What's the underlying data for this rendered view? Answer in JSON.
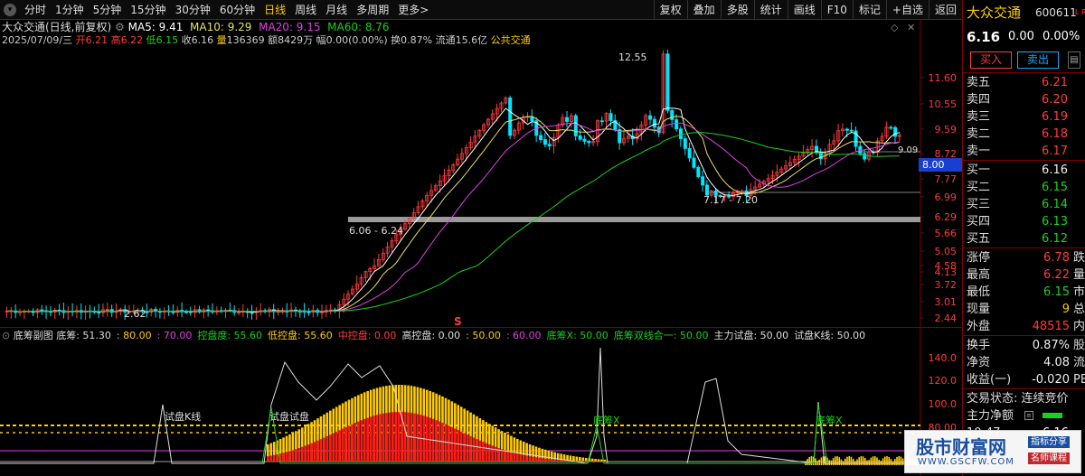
{
  "toolbar": {
    "periods": [
      "分时",
      "1分钟",
      "5分钟",
      "15分钟",
      "30分钟",
      "60分钟",
      "日线",
      "周线",
      "月线",
      "多周期",
      "更多>"
    ],
    "active_period": "日线",
    "buttons": [
      "复权",
      "叠加",
      "多股",
      "统计",
      "画线",
      "F10",
      "标记",
      "+自选",
      "返回"
    ]
  },
  "chart_header": {
    "stock_label": "大众交通(日线,前复权)",
    "ma5": "MA5: 9.41",
    "ma10": "MA10: 9.29",
    "ma20": "MA20: 9.15",
    "ma60": "MA60: 8.76",
    "date": "2025/07/09/三",
    "open_label": "开",
    "open": "6.21",
    "high_label": "高",
    "high": "6.22",
    "low_label": "低",
    "low": "6.15",
    "close_label": "收",
    "close": "6.16",
    "vol_label": "量",
    "volume": "136369",
    "amt_label": "额",
    "amount": "8429万",
    "chg_label": "幅",
    "change": "0.00(0.00%)",
    "turnover_label": "换",
    "turnover": "0.87%",
    "float_label": "流通",
    "float_cap": "15.6亿",
    "concept": "公共交通"
  },
  "price_axis": [
    "11.60",
    "10.55",
    "9.59",
    "8.72",
    "7.77",
    "6.99",
    "6.29",
    "5.66",
    "5.05",
    "4.58",
    "4.13",
    "3.72",
    "3.01",
    "2.44"
  ],
  "chart_annotations": {
    "peak": "12.55",
    "low": "2.62",
    "gap1": "6.06 - 6.24",
    "gap2": "7.17 - 7.20",
    "line_value": "9.09",
    "current_box": "8.00",
    "signal": "S"
  },
  "sub_header": {
    "title": "底筹副图",
    "items": [
      {
        "text": "底筹: 51.30",
        "color": "#dddddd"
      },
      {
        "text": ": 80.00",
        "color": "#ffcc00"
      },
      {
        "text": ": 70.00",
        "color": "#e040e0"
      },
      {
        "text": "控盘度: 55.60",
        "color": "#19d219"
      },
      {
        "text": "低控盘: 55.60",
        "color": "#ffcc00"
      },
      {
        "text": "中控盘: 0.00",
        "color": "#ff3b3b"
      },
      {
        "text": "高控盘: 0.00",
        "color": "#dddddd"
      },
      {
        "text": ": 50.00",
        "color": "#ffcc00"
      },
      {
        "text": ": 60.00",
        "color": "#e040e0"
      },
      {
        "text": "底筹X: 50.00",
        "color": "#19d219"
      },
      {
        "text": "底筹双线合一: 50.00",
        "color": "#19d219"
      },
      {
        "text": "主力试盘: 50.00",
        "color": "#dddddd"
      },
      {
        "text": "试盘K线: 50.00",
        "color": "#dddddd"
      }
    ],
    "axis": [
      "140.0",
      "120.0",
      "100.0",
      "80.00"
    ],
    "labels": [
      "试盘K线",
      "试盘试盘",
      "底筹X",
      "底筹X"
    ]
  },
  "quote": {
    "name": "大众交通",
    "code": "600611",
    "tag": "L R",
    "price": "6.16",
    "change": "0.00",
    "pct": "0.00%",
    "buy_btn": "买入",
    "sell_btn": "卖出",
    "asks": [
      {
        "label": "卖五",
        "price": "6.21"
      },
      {
        "label": "卖四",
        "price": "6.20"
      },
      {
        "label": "卖三",
        "price": "6.19"
      },
      {
        "label": "卖二",
        "price": "6.18"
      },
      {
        "label": "卖一",
        "price": "6.17"
      }
    ],
    "bids": [
      {
        "label": "买一",
        "price": "6.16"
      },
      {
        "label": "买二",
        "price": "6.15"
      },
      {
        "label": "买三",
        "price": "6.14"
      },
      {
        "label": "买四",
        "price": "6.13"
      },
      {
        "label": "买五",
        "price": "6.12"
      }
    ],
    "stats": [
      {
        "label": "涨停",
        "value": "6.78",
        "tail": "跌"
      },
      {
        "label": "最高",
        "value": "6.22",
        "tail": "量"
      },
      {
        "label": "最低",
        "value": "6.15",
        "tail": "市"
      },
      {
        "label": "现量",
        "value": "9",
        "tail": "总"
      },
      {
        "label": "外盘",
        "value": "48515",
        "tail": "内"
      }
    ],
    "stats2": [
      {
        "label": "换手",
        "value": "0.87%",
        "tail": "股"
      },
      {
        "label": "净资",
        "value": "4.08",
        "tail": "流"
      },
      {
        "label": "收益(一)",
        "value": "-0.020",
        "tail": "PE"
      }
    ],
    "trade_status": "交易状态: 连续竞价",
    "main_flow": "主力净额",
    "time": "10:47",
    "time_price": "6.16"
  },
  "watermark": {
    "title": "股市财富网",
    "url": "WWW.GSCFW.COM",
    "tag1": "指标分享",
    "tag2": "名师课程"
  },
  "colors": {
    "up": "#ff3b3b",
    "down": "#00e5ff",
    "ma5": "#ffffff",
    "ma10": "#e8e060",
    "ma20": "#e040e0",
    "ma60": "#19d219"
  }
}
